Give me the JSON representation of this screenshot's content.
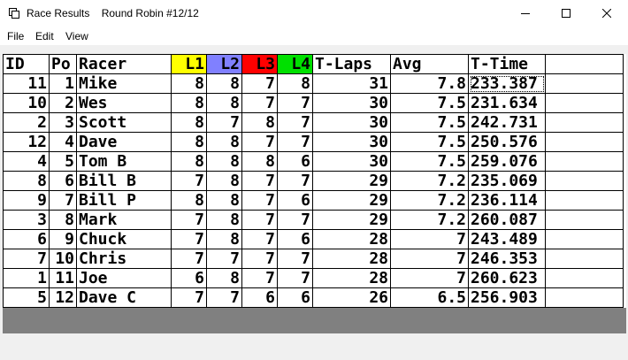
{
  "window": {
    "title": "Race Results",
    "subtitle": "Round Robin #12/12"
  },
  "menu": {
    "file": "File",
    "edit": "Edit",
    "view": "View"
  },
  "columns": [
    {
      "key": "id",
      "label": "ID",
      "align": "left",
      "width": 52,
      "bg": "#ffffff"
    },
    {
      "key": "pos",
      "label": "Po",
      "align": "left",
      "width": 31,
      "bg": "#ffffff"
    },
    {
      "key": "racer",
      "label": "Racer",
      "align": "left",
      "width": 107,
      "bg": "#ffffff"
    },
    {
      "key": "l1",
      "label": "L1",
      "align": "right",
      "width": 40,
      "bg": "#ffff00"
    },
    {
      "key": "l2",
      "label": "L2",
      "align": "right",
      "width": 40,
      "bg": "#8080ff"
    },
    {
      "key": "l3",
      "label": "L3",
      "align": "right",
      "width": 40,
      "bg": "#ff0000"
    },
    {
      "key": "l4",
      "label": "L4",
      "align": "right",
      "width": 40,
      "bg": "#00e000"
    },
    {
      "key": "tlaps",
      "label": "T-Laps",
      "align": "left",
      "width": 88,
      "bg": "#ffffff"
    },
    {
      "key": "avg",
      "label": "Avg",
      "align": "left",
      "width": 88,
      "bg": "#ffffff"
    },
    {
      "key": "ttime",
      "label": "T-Time",
      "align": "left",
      "width": 87,
      "bg": "#ffffff"
    },
    {
      "key": "extra",
      "label": "",
      "align": "left",
      "width": 88,
      "bg": "#ffffff"
    }
  ],
  "rows": [
    {
      "id": "11",
      "pos": "1",
      "racer": "Mike",
      "l1": "8",
      "l2": "8",
      "l3": "7",
      "l4": "8",
      "tlaps": "31",
      "avg": "7.8",
      "ttime": "233.387"
    },
    {
      "id": "10",
      "pos": "2",
      "racer": "Wes",
      "l1": "8",
      "l2": "8",
      "l3": "7",
      "l4": "7",
      "tlaps": "30",
      "avg": "7.5",
      "ttime": "231.634"
    },
    {
      "id": "2",
      "pos": "3",
      "racer": "Scott",
      "l1": "8",
      "l2": "7",
      "l3": "8",
      "l4": "7",
      "tlaps": "30",
      "avg": "7.5",
      "ttime": "242.731"
    },
    {
      "id": "12",
      "pos": "4",
      "racer": "Dave",
      "l1": "8",
      "l2": "8",
      "l3": "7",
      "l4": "7",
      "tlaps": "30",
      "avg": "7.5",
      "ttime": "250.576"
    },
    {
      "id": "4",
      "pos": "5",
      "racer": "Tom B",
      "l1": "8",
      "l2": "8",
      "l3": "8",
      "l4": "6",
      "tlaps": "30",
      "avg": "7.5",
      "ttime": "259.076"
    },
    {
      "id": "8",
      "pos": "6",
      "racer": "Bill B",
      "l1": "7",
      "l2": "8",
      "l3": "7",
      "l4": "7",
      "tlaps": "29",
      "avg": "7.2",
      "ttime": "235.069"
    },
    {
      "id": "9",
      "pos": "7",
      "racer": "Bill P",
      "l1": "8",
      "l2": "8",
      "l3": "7",
      "l4": "6",
      "tlaps": "29",
      "avg": "7.2",
      "ttime": "236.114"
    },
    {
      "id": "3",
      "pos": "8",
      "racer": "Mark",
      "l1": "7",
      "l2": "8",
      "l3": "7",
      "l4": "7",
      "tlaps": "29",
      "avg": "7.2",
      "ttime": "260.087"
    },
    {
      "id": "6",
      "pos": "9",
      "racer": "Chuck",
      "l1": "7",
      "l2": "8",
      "l3": "7",
      "l4": "6",
      "tlaps": "28",
      "avg": "7",
      "ttime": "243.489"
    },
    {
      "id": "7",
      "pos": "10",
      "racer": "Chris",
      "l1": "7",
      "l2": "7",
      "l3": "7",
      "l4": "7",
      "tlaps": "28",
      "avg": "7",
      "ttime": "246.353"
    },
    {
      "id": "1",
      "pos": "11",
      "racer": "Joe",
      "l1": "6",
      "l2": "8",
      "l3": "7",
      "l4": "7",
      "tlaps": "28",
      "avg": "7",
      "ttime": "260.623"
    },
    {
      "id": "5",
      "pos": "12",
      "racer": "Dave C",
      "l1": "7",
      "l2": "7",
      "l3": "6",
      "l4": "6",
      "tlaps": "26",
      "avg": "6.5",
      "ttime": "256.903"
    }
  ],
  "right_align_keys": [
    "id",
    "pos",
    "l1",
    "l2",
    "l3",
    "l4",
    "tlaps",
    "avg",
    "ttime"
  ]
}
